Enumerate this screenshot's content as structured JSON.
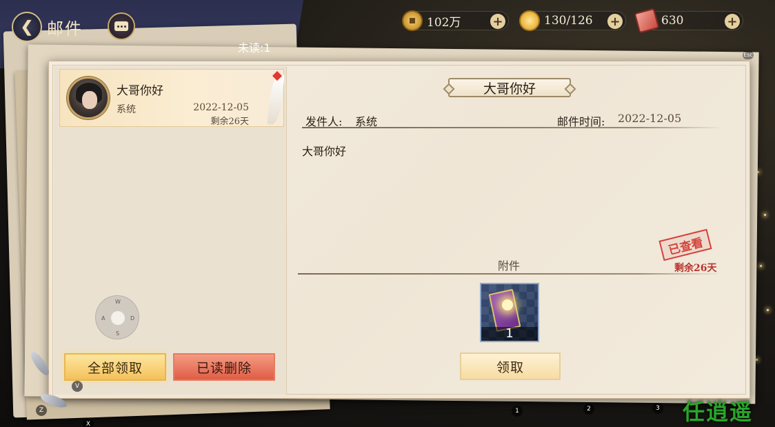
{
  "header": {
    "title": "邮件",
    "unread": "未读:1"
  },
  "currencies": [
    {
      "name": "coin",
      "value": "102万",
      "icon": "copper-coin-icon",
      "color": "#c8962f"
    },
    {
      "name": "gold",
      "value": "130/126",
      "icon": "gold-ingot-icon",
      "color": "#e8b23a"
    },
    {
      "name": "ticket",
      "value": "630",
      "icon": "red-ticket-icon",
      "color": "#c94a3d"
    }
  ],
  "mail_list": [
    {
      "title": "大哥你好",
      "sender": "系统",
      "date": "2022-12-05",
      "remaining": "剩余26天"
    }
  ],
  "detail": {
    "title": "大哥你好",
    "sender_label": "发件人:",
    "sender": "系统",
    "time_label": "邮件时间:",
    "time": "2022-12-05",
    "body": "大哥你好",
    "stamp": "已查看",
    "remaining": "剩余26天",
    "attachment_label": "附件",
    "attachment": {
      "count": "1",
      "icon": "purple-ticket-icon"
    },
    "claim_label": "领取"
  },
  "buttons": {
    "claim_all": "全部领取",
    "delete_read": "已读删除"
  },
  "joystick": {
    "up": "W",
    "left": "A",
    "right": "D",
    "down": "S"
  },
  "key_hints": {
    "esc": "Esc",
    "v": "V",
    "z": "Z",
    "x": "X",
    "k1": "1",
    "k2": "2",
    "k3": "3"
  },
  "watermark": "任逍遥"
}
